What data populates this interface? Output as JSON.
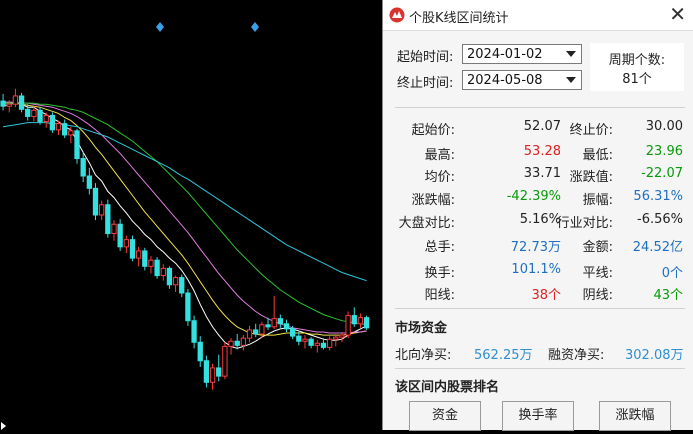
{
  "window": {
    "title": "个股K线区间统计",
    "close_glyph": "✕",
    "icon": "app-logo-icon"
  },
  "range": {
    "start_label": "起始时间:",
    "start_value": "2024-01-02",
    "end_label": "终止时间:",
    "end_value": "2024-05-08",
    "period_label": "周期个数:",
    "period_value": "81个"
  },
  "stats": {
    "open_label": "起始价:",
    "open_value": "52.07",
    "close_label": "终止价:",
    "close_value": "30.00",
    "high_label": "最高:",
    "high_value": "53.28",
    "low_label": "最低:",
    "low_value": "23.96",
    "avg_label": "均价:",
    "avg_value": "33.71",
    "change_label": "涨跌值:",
    "change_value": "-22.07",
    "pct_label": "涨跌幅:",
    "pct_value": "-42.39%",
    "amp_label": "振幅:",
    "amp_value": "56.31%",
    "market_label": "大盘对比:",
    "market_value": "5.16%",
    "industry_label": "行业对比:",
    "industry_value": "-6.56%",
    "volume_label": "总手:",
    "volume_value": "72.73万",
    "amount_label": "金额:",
    "amount_value": "24.52亿",
    "turnover_label": "换手:",
    "turnover_value": "101.1%",
    "flat_label": "平线:",
    "flat_value": "0个",
    "up_label": "阳线:",
    "up_value": "38个",
    "down_label": "阴线:",
    "down_value": "43个"
  },
  "funds": {
    "section_title": "市场资金",
    "north_label": "北向净买:",
    "north_value": "562.25万",
    "margin_label": "融资净买:",
    "margin_value": "302.08万"
  },
  "ranking": {
    "section_title": "该区间内股票排名",
    "buttons": [
      "资金",
      "换手率",
      "涨跌幅"
    ]
  },
  "colors": {
    "up": "#e02020",
    "down": "#0a9a0a",
    "neutral_value": "#1f6fc0",
    "chart_bg": "#000000"
  },
  "chart_data": {
    "type": "candlestick",
    "title": "",
    "series": [
      {
        "kind": "candles",
        "values": [
          [
            52.1,
            52.8,
            51.2,
            51.6
          ],
          [
            51.6,
            52.2,
            51.0,
            51.8
          ],
          [
            51.8,
            53.3,
            51.5,
            52.6
          ],
          [
            52.6,
            52.9,
            51.0,
            51.3
          ],
          [
            51.3,
            51.8,
            50.2,
            50.6
          ],
          [
            50.6,
            51.6,
            50.1,
            51.2
          ],
          [
            51.2,
            51.5,
            49.8,
            50.1
          ],
          [
            50.1,
            51.0,
            49.5,
            50.7
          ],
          [
            50.7,
            51.0,
            49.0,
            49.3
          ],
          [
            49.3,
            50.2,
            48.8,
            49.9
          ],
          [
            49.9,
            50.3,
            48.5,
            48.8
          ],
          [
            48.8,
            49.6,
            48.0,
            49.2
          ],
          [
            49.2,
            49.4,
            46.0,
            46.5
          ],
          [
            46.5,
            47.2,
            44.2,
            44.8
          ],
          [
            44.8,
            45.6,
            43.0,
            43.6
          ],
          [
            43.6,
            44.1,
            40.5,
            41.0
          ],
          [
            41.0,
            42.4,
            40.5,
            42.0
          ],
          [
            42.0,
            42.5,
            38.8,
            39.2
          ],
          [
            39.2,
            40.5,
            38.5,
            40.1
          ],
          [
            40.1,
            40.6,
            37.5,
            37.9
          ],
          [
            37.9,
            39.0,
            37.3,
            38.6
          ],
          [
            38.6,
            39.0,
            36.5,
            36.8
          ],
          [
            36.8,
            37.9,
            36.0,
            37.5
          ],
          [
            37.5,
            37.8,
            35.6,
            36.0
          ],
          [
            36.0,
            37.0,
            35.3,
            36.6
          ],
          [
            36.6,
            36.9,
            34.8,
            35.1
          ],
          [
            35.1,
            36.2,
            34.6,
            35.8
          ],
          [
            35.8,
            36.0,
            33.8,
            34.2
          ],
          [
            34.2,
            35.1,
            33.5,
            34.9
          ],
          [
            34.9,
            35.2,
            33.0,
            33.4
          ],
          [
            33.4,
            33.8,
            30.2,
            30.7
          ],
          [
            30.7,
            31.2,
            28.0,
            28.6
          ],
          [
            28.6,
            29.2,
            26.2,
            26.8
          ],
          [
            26.8,
            27.3,
            24.2,
            24.7
          ],
          [
            24.7,
            26.5,
            23.96,
            26.1
          ],
          [
            26.1,
            27.4,
            24.8,
            25.3
          ],
          [
            25.3,
            28.6,
            25.0,
            28.2
          ],
          [
            28.2,
            29.0,
            27.4,
            28.7
          ],
          [
            28.7,
            29.4,
            27.9,
            28.3
          ],
          [
            28.3,
            29.3,
            27.8,
            29.0
          ],
          [
            29.0,
            30.2,
            28.6,
            29.8
          ],
          [
            29.8,
            30.4,
            29.1,
            29.4
          ],
          [
            29.4,
            30.6,
            29.0,
            30.3
          ],
          [
            30.3,
            31.0,
            29.8,
            30.1
          ],
          [
            30.1,
            33.1,
            29.9,
            30.9
          ],
          [
            30.9,
            31.3,
            30.0,
            30.4
          ],
          [
            30.4,
            30.8,
            29.6,
            29.9
          ],
          [
            29.9,
            30.2,
            28.9,
            29.2
          ],
          [
            29.2,
            29.6,
            28.3,
            28.7
          ],
          [
            28.7,
            29.3,
            28.0,
            28.9
          ],
          [
            28.9,
            29.1,
            28.0,
            28.3
          ],
          [
            28.3,
            28.8,
            27.6,
            28.5
          ],
          [
            28.5,
            29.0,
            27.9,
            28.1
          ],
          [
            28.1,
            29.2,
            27.8,
            28.9
          ],
          [
            28.9,
            29.4,
            28.2,
            29.1
          ],
          [
            29.1,
            29.6,
            28.6,
            29.3
          ],
          [
            29.3,
            31.6,
            29.0,
            31.2
          ],
          [
            31.2,
            32.0,
            30.1,
            30.4
          ],
          [
            30.4,
            31.4,
            30.0,
            31.0
          ],
          [
            31.0,
            31.2,
            29.8,
            30.0
          ]
        ]
      },
      {
        "kind": "ma",
        "name": "",
        "color": "#ffffff",
        "values": [
          51.7,
          51.7,
          52.0,
          51.8,
          51.5,
          51.5,
          51.1,
          50.8,
          50.4,
          50.1,
          49.6,
          49.3,
          48.2,
          47.1,
          46.1,
          44.9,
          44.3,
          43.3,
          42.7,
          41.9,
          41.2,
          40.4,
          39.8,
          39.1,
          38.6,
          37.9,
          37.4,
          36.8,
          36.3,
          35.6,
          34.7,
          33.6,
          32.3,
          31.1,
          30.1,
          29.3,
          28.6,
          28.2,
          28.0,
          28.2,
          28.4,
          28.7,
          29.1,
          29.4,
          29.7,
          29.9,
          30.0,
          29.9,
          29.7,
          29.5,
          29.3,
          29.1,
          28.9,
          28.8,
          28.8,
          28.9,
          29.3,
          29.6,
          29.9,
          30.2
        ]
      },
      {
        "kind": "ma",
        "name": "",
        "color": "#f0e24a",
        "values": [
          51.9,
          51.9,
          51.9,
          51.8,
          51.7,
          51.6,
          51.5,
          51.3,
          51.1,
          50.9,
          50.5,
          50.2,
          49.7,
          49.1,
          48.4,
          47.6,
          46.9,
          46.1,
          45.3,
          44.5,
          43.7,
          42.9,
          42.1,
          41.3,
          40.6,
          39.9,
          39.2,
          38.5,
          37.8,
          37.1,
          36.3,
          35.4,
          34.5,
          33.6,
          32.7,
          31.9,
          31.2,
          30.6,
          30.1,
          29.8,
          29.5,
          29.4,
          29.3,
          29.3,
          29.3,
          29.4,
          29.5,
          29.5,
          29.5,
          29.5,
          29.4,
          29.4,
          29.3,
          29.3,
          29.3,
          29.3,
          29.4,
          29.5,
          29.6,
          29.7
        ]
      },
      {
        "kind": "ma",
        "name": "",
        "color": "#e07be0",
        "values": [
          52.0,
          52.0,
          52.0,
          51.9,
          51.9,
          51.8,
          51.7,
          51.6,
          51.5,
          51.3,
          51.1,
          50.9,
          50.6,
          50.2,
          49.8,
          49.3,
          48.8,
          48.2,
          47.6,
          47.0,
          46.3,
          45.6,
          44.9,
          44.2,
          43.5,
          42.8,
          42.1,
          41.4,
          40.7,
          40.0,
          39.3,
          38.5,
          37.7,
          36.9,
          36.1,
          35.3,
          34.6,
          33.9,
          33.2,
          32.6,
          32.1,
          31.6,
          31.2,
          30.9,
          30.6,
          30.4,
          30.2,
          30.0,
          29.9,
          29.8,
          29.7,
          29.6,
          29.6,
          29.5,
          29.5,
          29.5,
          29.5,
          29.6,
          29.6,
          29.7
        ]
      },
      {
        "kind": "ma",
        "name": "",
        "color": "#2ec22e",
        "values": [
          51.9,
          51.9,
          51.9,
          51.9,
          51.9,
          51.9,
          51.8,
          51.8,
          51.7,
          51.6,
          51.5,
          51.3,
          51.2,
          51.0,
          50.7,
          50.4,
          50.1,
          49.8,
          49.4,
          49.0,
          48.6,
          48.2,
          47.7,
          47.2,
          46.7,
          46.2,
          45.6,
          45.0,
          44.4,
          43.8,
          43.2,
          42.5,
          41.8,
          41.1,
          40.4,
          39.7,
          39.0,
          38.3,
          37.6,
          37.0,
          36.4,
          35.8,
          35.2,
          34.7,
          34.2,
          33.7,
          33.3,
          32.9,
          32.5,
          32.2,
          31.9,
          31.6,
          31.3,
          31.1,
          30.9,
          30.7,
          30.6,
          30.5,
          30.4,
          30.3
        ]
      },
      {
        "kind": "ma",
        "name": "",
        "color": "#2fc7d8",
        "values": [
          49.6,
          49.7,
          49.8,
          49.9,
          50.0,
          50.0,
          50.0,
          50.0,
          49.9,
          49.9,
          49.8,
          49.7,
          49.6,
          49.4,
          49.2,
          49.0,
          48.8,
          48.6,
          48.3,
          48.0,
          47.7,
          47.4,
          47.1,
          46.8,
          46.5,
          46.2,
          45.9,
          45.6,
          45.2,
          44.8,
          44.5,
          44.1,
          43.7,
          43.3,
          42.9,
          42.5,
          42.1,
          41.7,
          41.3,
          40.9,
          40.5,
          40.1,
          39.7,
          39.3,
          38.9,
          38.5,
          38.1,
          37.8,
          37.5,
          37.2,
          36.9,
          36.6,
          36.3,
          36.0,
          35.7,
          35.4,
          35.2,
          35.0,
          34.8,
          34.6
        ]
      }
    ],
    "markers": [
      "diamond",
      "diamond"
    ],
    "ylim": [
      22,
      60
    ]
  }
}
